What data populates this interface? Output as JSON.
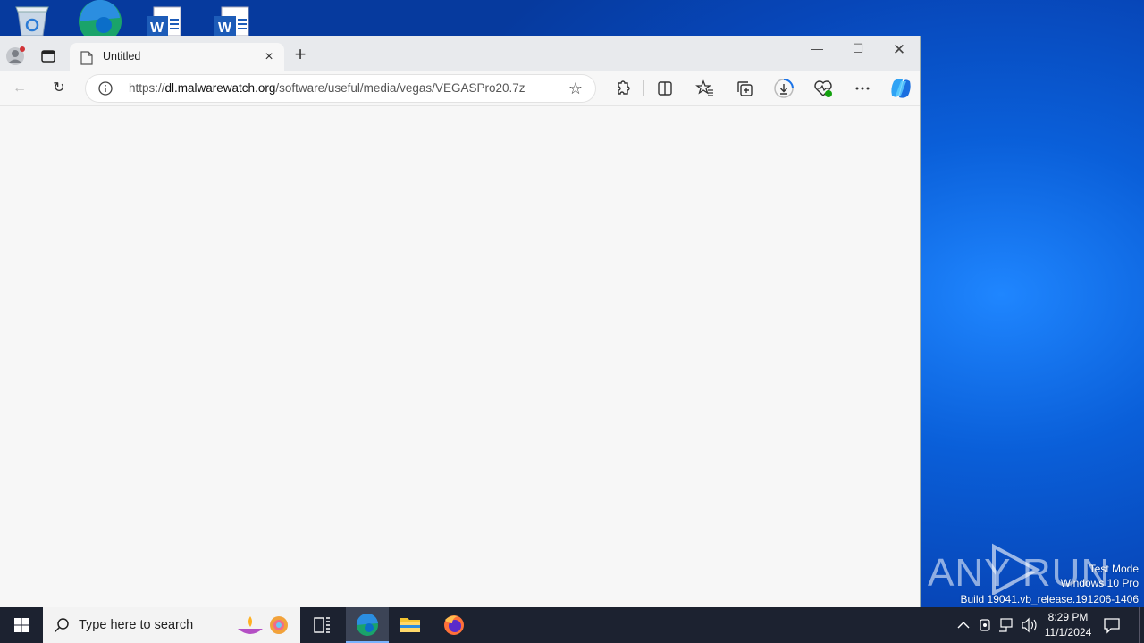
{
  "browser": {
    "tab": {
      "title": "Untitled",
      "close_icon": "×"
    },
    "new_tab_icon": "+",
    "window_controls": {
      "minimize": "—",
      "maximize": "☐",
      "close": "✕"
    },
    "toolbar": {
      "back_icon": "←",
      "reload_icon": "↻",
      "address": {
        "scheme": "https://",
        "host": "dl.malwarewatch.org",
        "path": "/software/useful/media/vegas/VEGASPro20.7z"
      },
      "favorite_icon": "☆"
    }
  },
  "taskbar": {
    "search_placeholder": "Type here to search",
    "clock_time": "8:29 PM",
    "clock_date": "11/1/2024"
  },
  "watermark": {
    "logo_text": "ANY RUN",
    "line1": "Test Mode",
    "line2": "Windows 10 Pro",
    "line3": "Build 19041.vb_release.191206-1406"
  }
}
